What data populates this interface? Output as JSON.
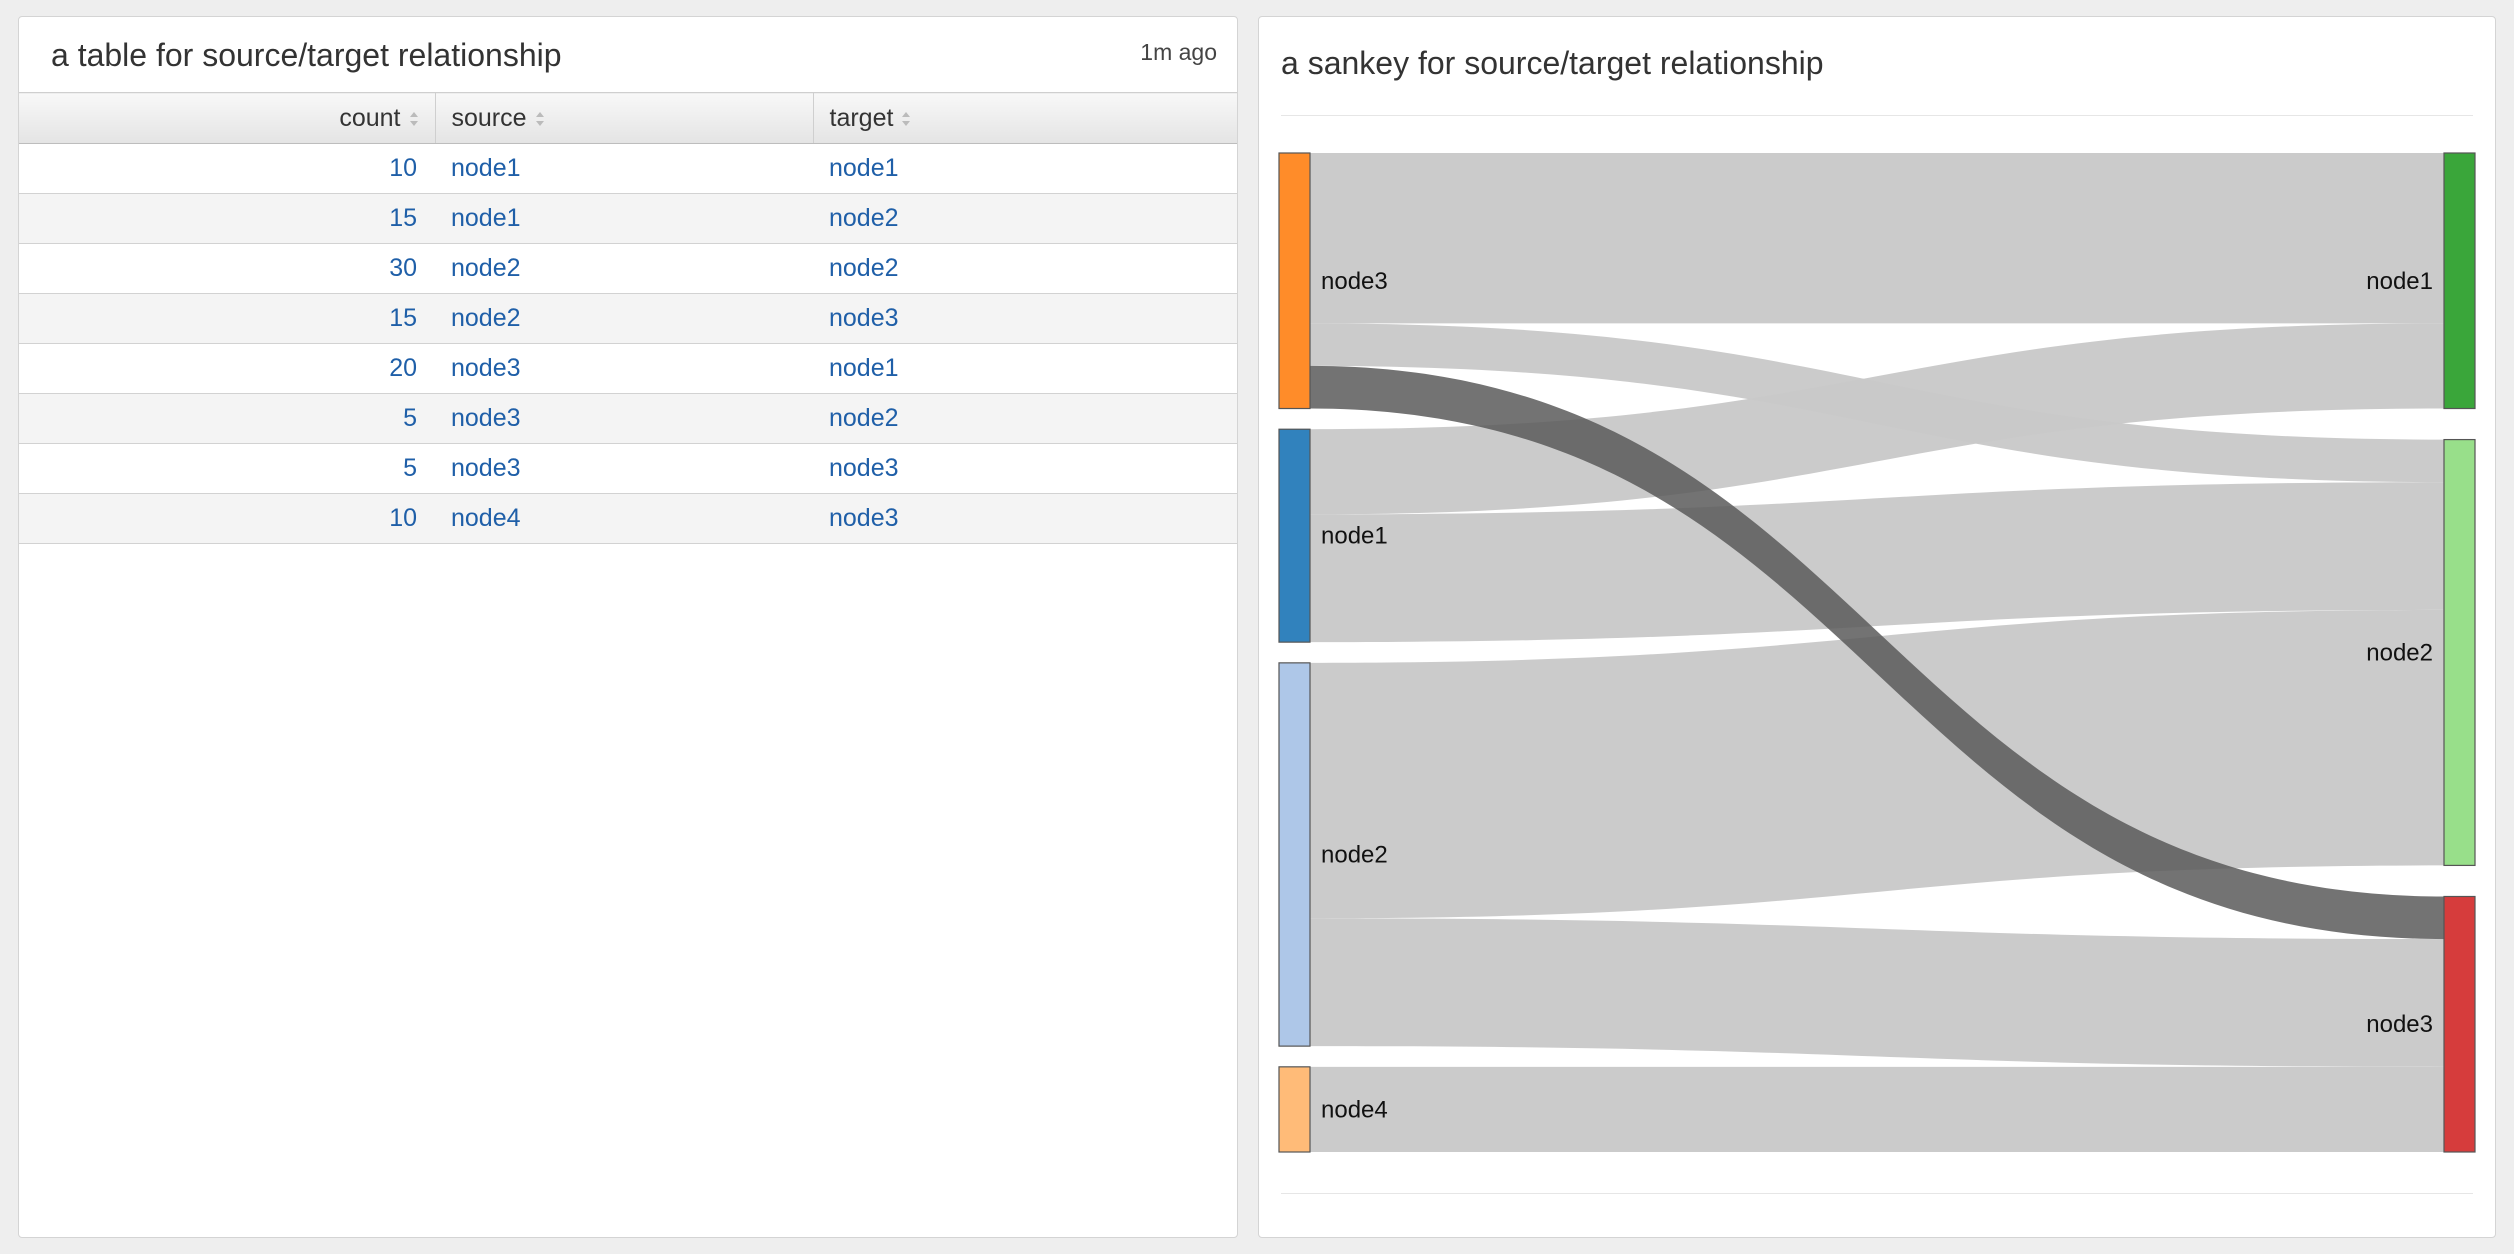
{
  "table_panel": {
    "title": "a table for source/target relationship",
    "updated": "1m ago",
    "columns": [
      "count",
      "source",
      "target"
    ],
    "rows": [
      [
        "10",
        "node1",
        "node1"
      ],
      [
        "15",
        "node1",
        "node2"
      ],
      [
        "30",
        "node2",
        "node2"
      ],
      [
        "15",
        "node2",
        "node3"
      ],
      [
        "20",
        "node3",
        "node1"
      ],
      [
        "5",
        "node3",
        "node2"
      ],
      [
        "5",
        "node3",
        "node3"
      ],
      [
        "10",
        "node4",
        "node3"
      ]
    ]
  },
  "sankey_panel": {
    "title": "a sankey for source/target relationship",
    "sources": [
      {
        "name": "node3",
        "color": "#ff8c29"
      },
      {
        "name": "node1",
        "color": "#3182bd"
      },
      {
        "name": "node2",
        "color": "#aec7e8"
      },
      {
        "name": "node4",
        "color": "#ffbb78"
      }
    ],
    "targets": [
      {
        "name": "node1",
        "color": "#3aa63a"
      },
      {
        "name": "node2",
        "color": "#98df8a"
      },
      {
        "name": "node3",
        "color": "#d63c3c"
      }
    ],
    "links": [
      {
        "source": "node3",
        "target": "node1",
        "value": 20
      },
      {
        "source": "node3",
        "target": "node2",
        "value": 5
      },
      {
        "source": "node3",
        "target": "node3",
        "value": 5,
        "highlighted": true
      },
      {
        "source": "node1",
        "target": "node1",
        "value": 10
      },
      {
        "source": "node1",
        "target": "node2",
        "value": 15
      },
      {
        "source": "node2",
        "target": "node2",
        "value": 30
      },
      {
        "source": "node2",
        "target": "node3",
        "value": 15
      },
      {
        "source": "node4",
        "target": "node3",
        "value": 10
      }
    ],
    "link_color": "#c8c8c8",
    "highlight_link_color": "#5a5a5a"
  }
}
